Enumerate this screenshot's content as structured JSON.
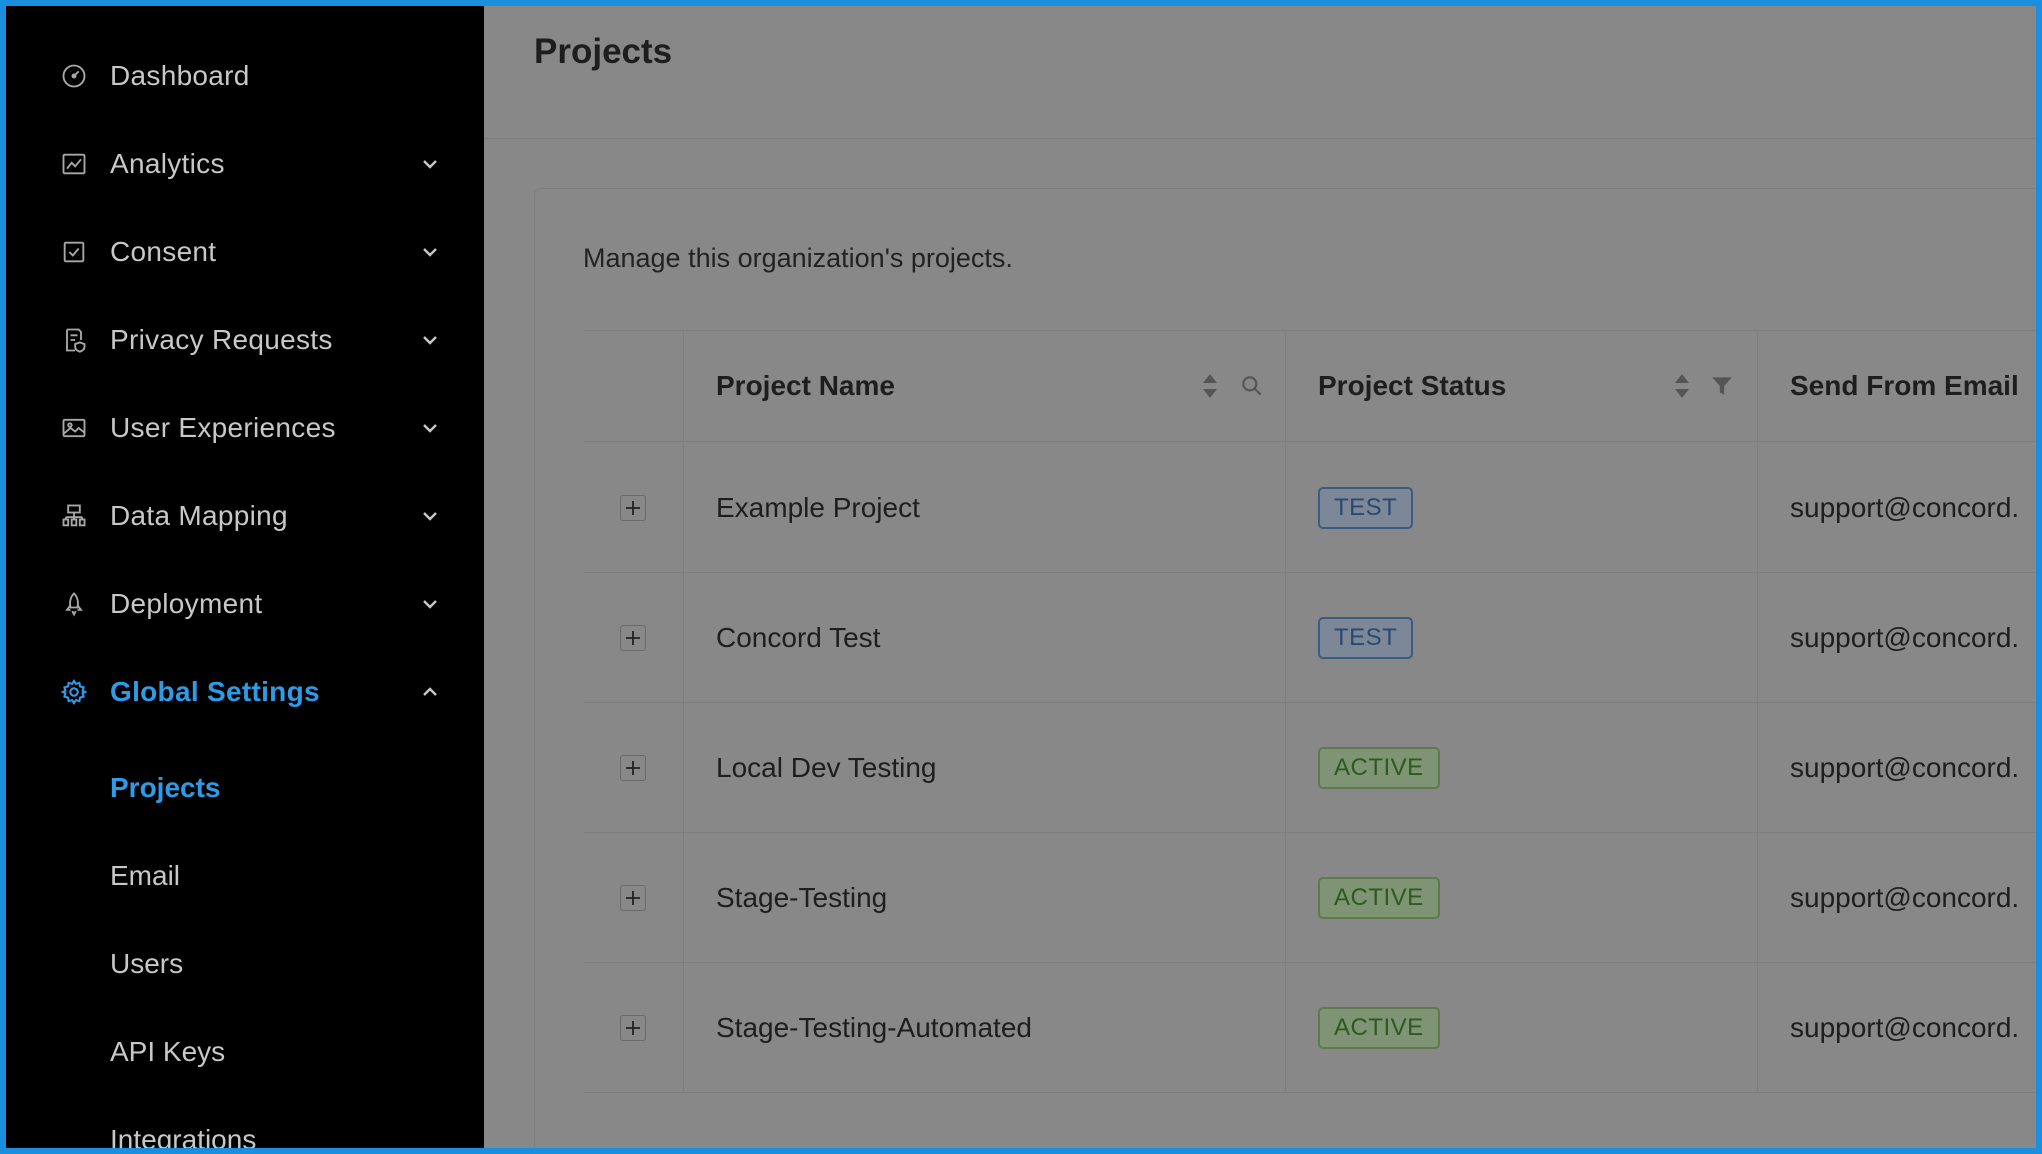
{
  "sidebar": {
    "items": [
      {
        "label": "Dashboard",
        "icon": "dashboard-icon",
        "has_chevron": false
      },
      {
        "label": "Analytics",
        "icon": "chart-icon",
        "has_chevron": true
      },
      {
        "label": "Consent",
        "icon": "checkbox-icon",
        "has_chevron": true
      },
      {
        "label": "Privacy Requests",
        "icon": "document-shield-icon",
        "has_chevron": true
      },
      {
        "label": "User Experiences",
        "icon": "image-icon",
        "has_chevron": true
      },
      {
        "label": "Data Mapping",
        "icon": "hierarchy-icon",
        "has_chevron": true
      },
      {
        "label": "Deployment",
        "icon": "rocket-icon",
        "has_chevron": true
      },
      {
        "label": "Global Settings",
        "icon": "gear-icon",
        "has_chevron": true,
        "expanded": true,
        "active": true
      }
    ],
    "sub_items": [
      {
        "label": "Projects",
        "active": true
      },
      {
        "label": "Email"
      },
      {
        "label": "Users"
      },
      {
        "label": "API Keys"
      },
      {
        "label": "Integrations"
      }
    ]
  },
  "header": {
    "title": "Projects"
  },
  "main": {
    "description": "Manage this organization's projects.",
    "table": {
      "columns": [
        "Project Name",
        "Project Status",
        "Send From Email"
      ],
      "rows": [
        {
          "name": "Example Project",
          "status": "TEST",
          "email": "support@concord."
        },
        {
          "name": "Concord Test",
          "status": "TEST",
          "email": "support@concord."
        },
        {
          "name": "Local Dev Testing",
          "status": "ACTIVE",
          "email": "support@concord."
        },
        {
          "name": "Stage-Testing",
          "status": "ACTIVE",
          "email": "support@concord."
        },
        {
          "name": "Stage-Testing-Automated",
          "status": "ACTIVE",
          "email": "support@concord."
        }
      ]
    }
  },
  "colors": {
    "sidebar_bg": "#000000",
    "accent": "#2f9be6",
    "overlay_bg": "#888888",
    "frame_border": "#1a8fe0"
  }
}
